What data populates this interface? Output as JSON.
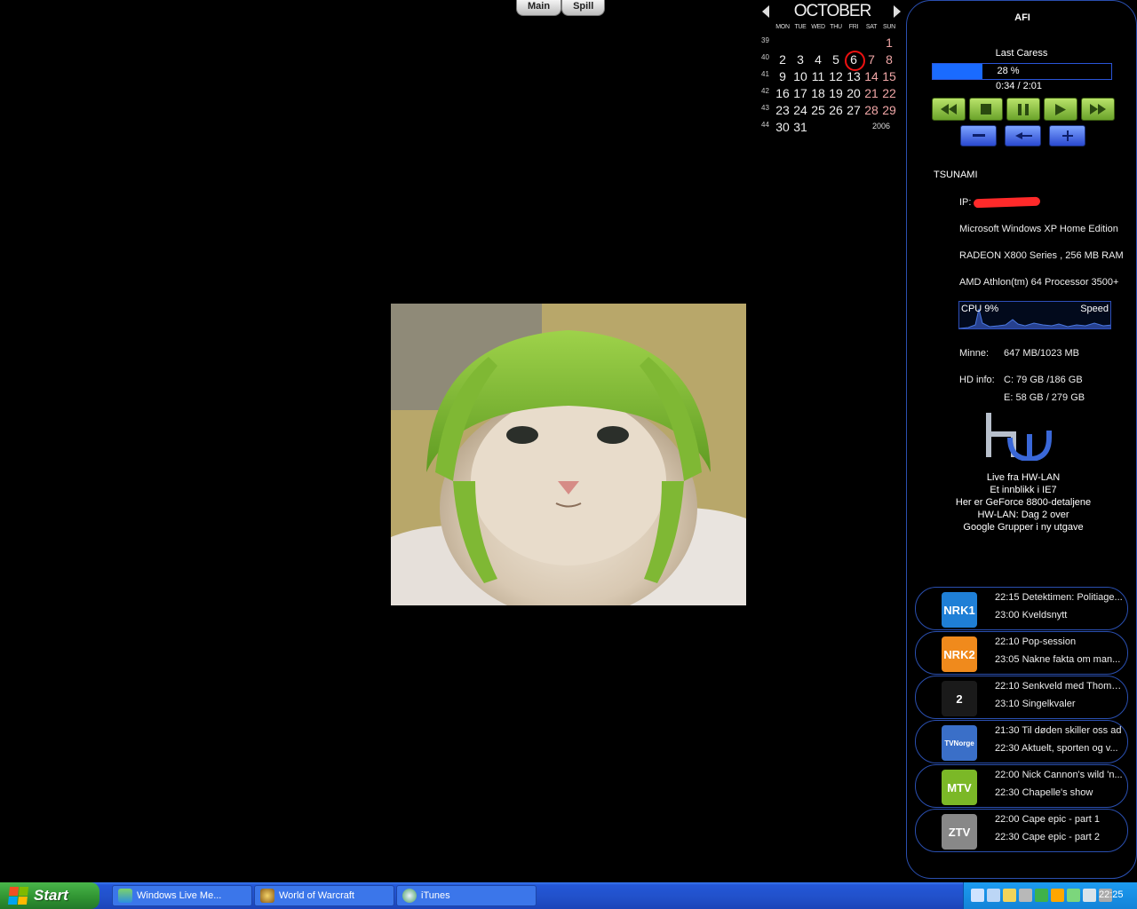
{
  "tabs": [
    "Main",
    "Spill"
  ],
  "calendar": {
    "month": "OCTOBER",
    "year": "2006",
    "dow": [
      "MON",
      "TUE",
      "WED",
      "THU",
      "FRI",
      "SAT",
      "SUN"
    ],
    "weeks": [
      {
        "wk": "39",
        "days": [
          "",
          "",
          "",
          "",
          "",
          "",
          "1"
        ]
      },
      {
        "wk": "40",
        "days": [
          "2",
          "3",
          "4",
          "5",
          "6",
          "7",
          "8"
        ]
      },
      {
        "wk": "41",
        "days": [
          "9",
          "10",
          "11",
          "12",
          "13",
          "14",
          "15"
        ]
      },
      {
        "wk": "42",
        "days": [
          "16",
          "17",
          "18",
          "19",
          "20",
          "21",
          "22"
        ]
      },
      {
        "wk": "43",
        "days": [
          "23",
          "24",
          "25",
          "26",
          "27",
          "28",
          "29"
        ]
      },
      {
        "wk": "44",
        "days": [
          "30",
          "31",
          "",
          "",
          "",
          "",
          ""
        ]
      }
    ],
    "today": "6"
  },
  "player": {
    "artist": "AFI",
    "track": "Last Caress",
    "progress_percent": 28,
    "progress_label": "28 %",
    "time": "0:34 / 2:01",
    "controls": [
      "rewind-icon",
      "stop-icon",
      "pause-icon",
      "play-icon",
      "fast-forward-icon"
    ],
    "volume": [
      "volume-down-icon",
      "mute-icon",
      "volume-up-icon"
    ]
  },
  "system": {
    "host": "TSUNAMI",
    "ip_label": "IP:",
    "os": "Microsoft Windows XP Home Edition",
    "gpu": "RADEON X800 Series  , 256 MB RAM",
    "cpu_name": "AMD Athlon(tm) 64 Processor 3500+",
    "cpu_label": "CPU  9%",
    "speed_label": "Speed",
    "mem_label": "Minne:",
    "mem_value": "647 MB/1023 MB",
    "hd_label": "HD info:",
    "hd_c": "C: 79 GB /186 GB",
    "hd_e": "E: 58 GB /   279 GB"
  },
  "news": [
    "Live fra HW-LAN",
    "Et innblikk i IE7",
    "Her er GeForce 8800-detaljene",
    "HW-LAN: Dag 2 over",
    "Google Grupper i ny utgave"
  ],
  "tv": [
    {
      "logo": "NRK1",
      "color": "#1f7fd6",
      "l1": "22:15 Detektimen: Politiage...",
      "l2": "23:00 Kveldsnytt"
    },
    {
      "logo": "NRK2",
      "color": "#f08a1c",
      "l1": "22:10 Pop-session",
      "l2": "23:05 Nakne fakta om man..."
    },
    {
      "logo": "2",
      "color": "#1a1a1a",
      "l1": "22:10 Senkveld med Thoma...",
      "l2": "23:10 Singelkvaler"
    },
    {
      "logo": "TVNorge",
      "color": "#3a6fc8",
      "l1": "21:30 Til døden skiller oss ad",
      "l2": "22:30 Aktuelt, sporten og v..."
    },
    {
      "logo": "MTV",
      "color": "#7bb827",
      "l1": "22:00 Nick Cannon's wild 'n...",
      "l2": "22:30 Chapelle's show"
    },
    {
      "logo": "ZTV",
      "color": "#888888",
      "l1": "22:00 Cape epic - part 1",
      "l2": "22:30 Cape epic - part 2"
    }
  ],
  "taskbar": {
    "start": "Start",
    "tasks": [
      "Windows Live Me...",
      "World of Warcraft",
      "iTunes"
    ],
    "clock": "22:25"
  }
}
